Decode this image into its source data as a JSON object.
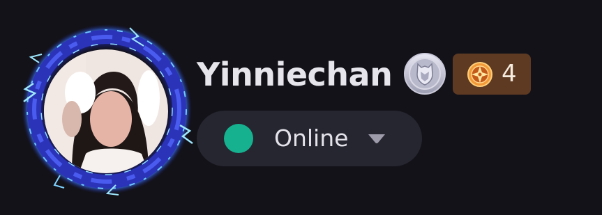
{
  "profile": {
    "username": "Yinniechan",
    "points": "4"
  },
  "status": {
    "label": "Online",
    "color": "#16b18f"
  },
  "icons": {
    "avatar_frame": "electric-ring-frame-icon",
    "rank_badge": "shield-badge-icon",
    "points": "compass-star-icon",
    "caret": "chevron-down-icon"
  },
  "colors": {
    "background": "#131219",
    "pill": "#262630",
    "points_badge": "#5e3a22",
    "frame_blue": "#2d3bd6"
  }
}
